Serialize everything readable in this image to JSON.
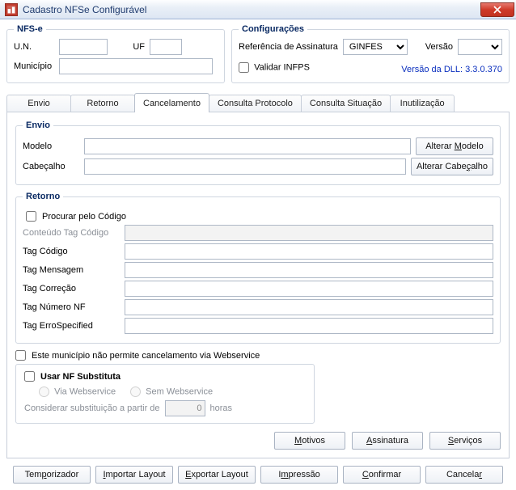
{
  "titlebar": {
    "title": "Cadastro NFSe Configurável"
  },
  "nfse": {
    "legend": "NFS-e",
    "un_label": "U.N.",
    "uf_label": "UF",
    "mun_label": "Município",
    "un_value": "",
    "uf_value": "",
    "mun_value": ""
  },
  "config": {
    "legend": "Configurações",
    "ref_label": "Referência de Assinatura",
    "ref_value": "GINFES",
    "versao_label": "Versão",
    "versao_value": "",
    "validar_label": "Validar INFPS",
    "dll_label": "Versão da DLL: 3.3.0.370"
  },
  "tabs": [
    "Envio",
    "Retorno",
    "Cancelamento",
    "Consulta Protocolo",
    "Consulta Situação",
    "Inutilização"
  ],
  "active_tab": "Cancelamento",
  "envio_box": {
    "legend": "Envio",
    "modelo_label": "Modelo",
    "cabecalho_label": "Cabeçalho",
    "modelo_value": "",
    "cabecalho_value": "",
    "alterar_modelo": "Alterar Modelo",
    "alterar_cabecalho": "Alterar Cabeçalho"
  },
  "retorno_box": {
    "legend": "Retorno",
    "procurar_label": "Procurar pelo Código",
    "fields": {
      "conteudo": {
        "label": "Conteúdo Tag Código",
        "value": "",
        "disabled": true
      },
      "tagcodigo": {
        "label": "Tag Código",
        "value": ""
      },
      "tagmsg": {
        "label": "Tag Mensagem",
        "value": ""
      },
      "tagcorr": {
        "label": "Tag Correção",
        "value": ""
      },
      "tagnum": {
        "label": "Tag Número NF",
        "value": ""
      },
      "tagerro": {
        "label": "Tag ErroSpecified",
        "value": ""
      }
    }
  },
  "mun_cancel_label": "Este município não permite cancelamento via Webservice",
  "substituta": {
    "title": "Usar NF Substituta",
    "via_ws": "Via Webservice",
    "sem_ws": "Sem Webservice",
    "consider_label_pre": "Considerar substituição a partir de",
    "consider_value": "0",
    "consider_label_post": "horas"
  },
  "mid_buttons": {
    "motivos": "Motivos",
    "assinatura": "Assinatura",
    "servicos": "Serviços"
  },
  "bottom_buttons": {
    "temporizador": "Temporizador",
    "importar": "Importar Layout",
    "exportar": "Exportar Layout",
    "impressao": "Impressão",
    "confirmar": "Confirmar",
    "cancelar": "Cancelar"
  }
}
